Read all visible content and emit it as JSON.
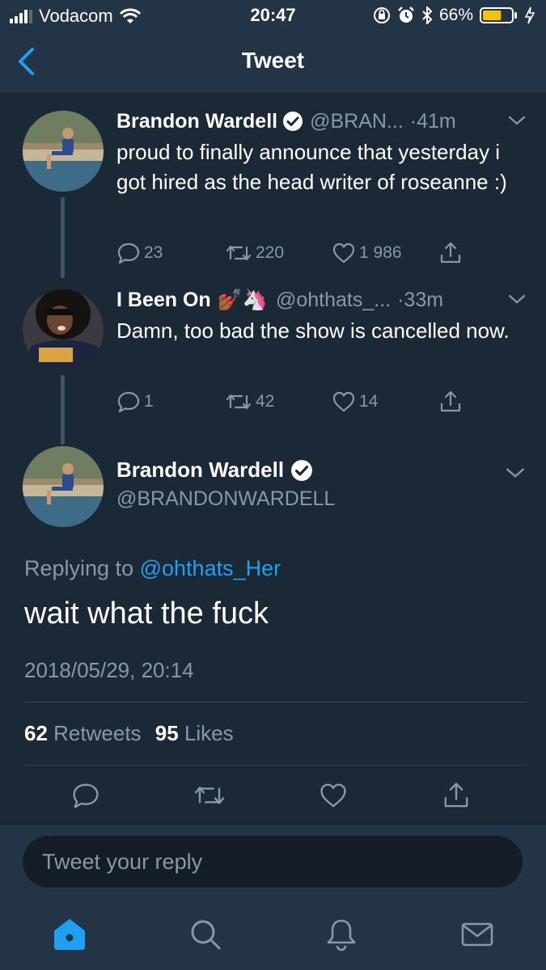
{
  "status_bar": {
    "carrier": "Vodacom",
    "time": "20:47",
    "battery": "66%",
    "battery_level": 0.66,
    "battery_color": "#f5c400"
  },
  "nav": {
    "title": "Tweet",
    "back_icon": "chevron-left-icon"
  },
  "thread": [
    {
      "name": "Brandon Wardell",
      "verified": true,
      "handle": "@BRAN...",
      "dot": "·",
      "time": "41m",
      "text": "proud to finally announce that yesterday i got hired as the head writer of roseanne :)",
      "replies": "23",
      "retweets": "220",
      "likes": "1 986"
    },
    {
      "name": "I Been On",
      "emoji": "💅🏾🦄",
      "handle": "@ohthats_...",
      "dot": "·",
      "time": "33m",
      "text": "Damn, too bad the show is cancelled now.",
      "replies": "1",
      "retweets": "42",
      "likes": "14"
    }
  ],
  "main_tweet": {
    "name": "Brandon Wardell",
    "handle": "@BRANDONWARDELL",
    "replying_prefix": "Replying to",
    "replying_to": "@ohthats_Her",
    "text": "wait what the fuck",
    "date": "2018/05/29, 20:14",
    "retweets_count": "62",
    "retweets_label": "Retweets",
    "likes_count": "95",
    "likes_label": "Likes"
  },
  "reply": {
    "placeholder": "Tweet your reply"
  },
  "tabs": [
    "home-icon",
    "search-icon",
    "notifications-icon",
    "messages-icon"
  ],
  "colors": {
    "background": "#1b2836",
    "bar": "#243447",
    "accent": "#1da1f2",
    "muted": "#8899a6"
  }
}
